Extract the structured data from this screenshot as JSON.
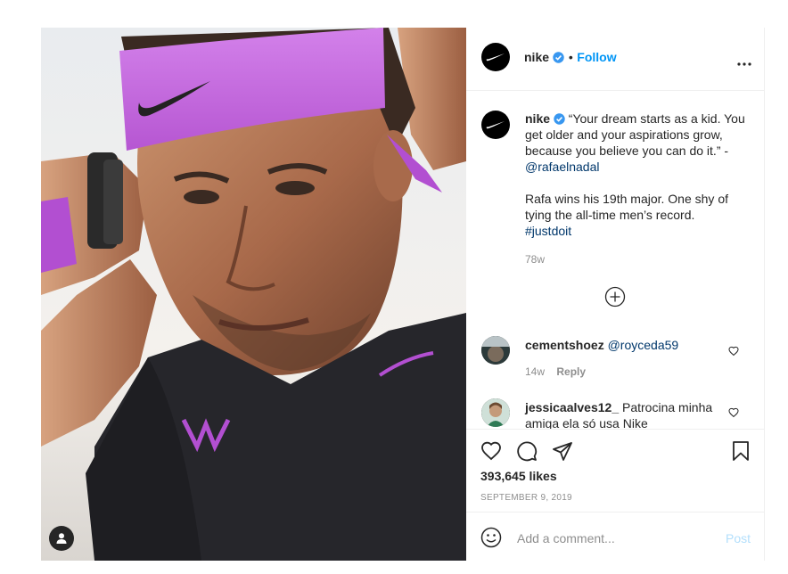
{
  "header": {
    "username": "nike",
    "separator": "•",
    "follow_label": "Follow",
    "more_label": "•••"
  },
  "caption": {
    "username": "nike",
    "text_1": "“Your dream starts as a kid. You get older and your aspirations grow, because you believe you can do it.” -",
    "mention": "@rafaelnadal",
    "text_2": "Rafa wins his 19th major. One shy of tying the all-time men’s record.",
    "hashtag": "#justdoit",
    "time": "78w"
  },
  "comments": [
    {
      "username": "cementshoez",
      "text": "@royceda59",
      "time": "14w",
      "reply_label": "Reply"
    },
    {
      "username": "jessicaalves12_",
      "text": "Patrocina minha amiga ela só usa Nike"
    }
  ],
  "stats": {
    "likes": "393,645 likes",
    "date": "SEPTEMBER 9, 2019"
  },
  "add_comment": {
    "placeholder": "Add a comment...",
    "post_label": "Post"
  },
  "colors": {
    "accent": "#0095f6",
    "headband": "#c46de0",
    "link": "#00376b"
  },
  "icons": [
    "swoosh-icon",
    "verified-icon",
    "more-icon",
    "plus-circle-icon",
    "heart-icon",
    "comment-icon",
    "share-icon",
    "bookmark-icon",
    "emoji-icon",
    "user-tag-icon"
  ]
}
